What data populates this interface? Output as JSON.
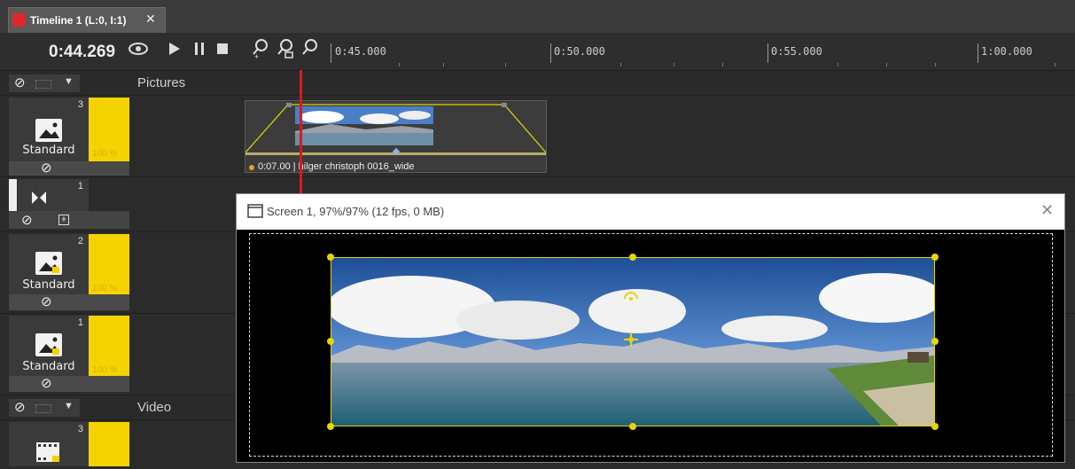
{
  "tab": {
    "title": "Timeline 1 (L:0, I:1)",
    "close": "✕"
  },
  "toolbar": {
    "time": "0:44.269"
  },
  "ruler": {
    "labels": [
      "0:45.000",
      "0:50.000",
      "0:55.000",
      "1:00.000"
    ]
  },
  "groups": {
    "pictures": "Pictures",
    "video": "Video"
  },
  "tracks": [
    {
      "number": "3",
      "label": "Standard",
      "percent": "100 %"
    },
    {
      "number": "1"
    },
    {
      "number": "2",
      "label": "Standard",
      "percent": "100 %"
    },
    {
      "number": "1",
      "label": "Standard",
      "percent": "100 %"
    },
    {
      "number": "3"
    }
  ],
  "clip": {
    "label": "0:07.00 | hilger christoph 0016_wide"
  },
  "screen": {
    "title": "Screen 1, 97%/97% (12 fps, 0 MB)",
    "close": "✕"
  },
  "colors": {
    "playhead": "#e8141a",
    "track_opacity": "#f5d300",
    "selection": "#e6d600",
    "tab_marker": "#e0282a"
  }
}
